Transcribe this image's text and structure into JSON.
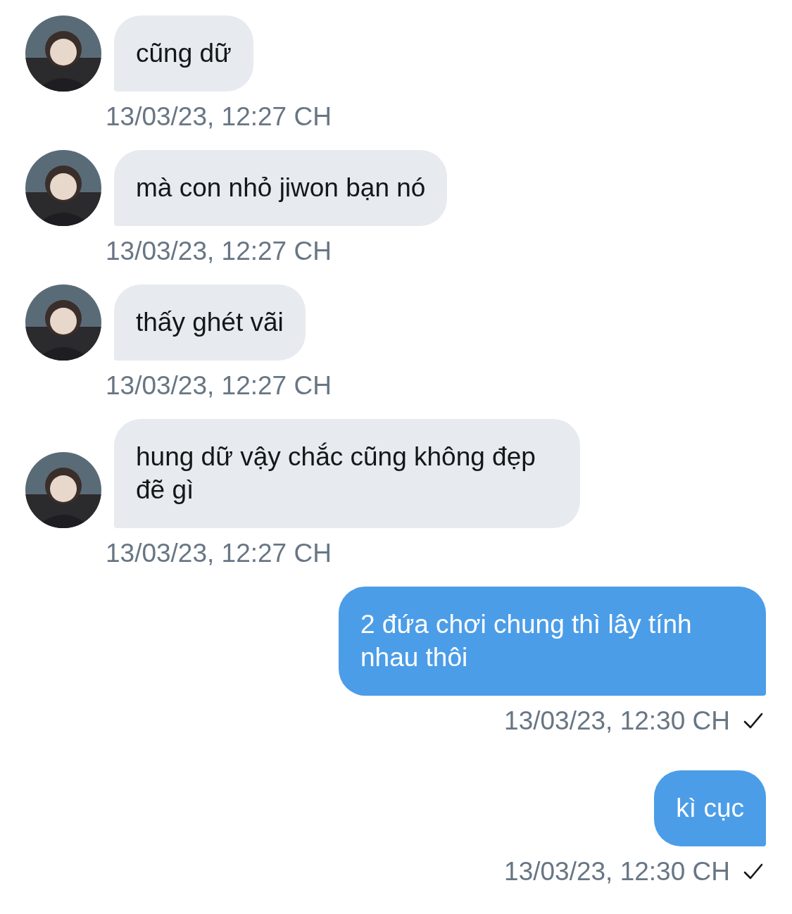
{
  "messages": [
    {
      "kind": "incoming",
      "text": "cũng dữ",
      "time": "13/03/23, 12:27 CH"
    },
    {
      "kind": "incoming",
      "text": "mà con nhỏ jiwon bạn nó",
      "time": "13/03/23, 12:27 CH"
    },
    {
      "kind": "incoming",
      "text": "thấy ghét vãi",
      "time": "13/03/23, 12:27 CH"
    },
    {
      "kind": "incoming",
      "text": "hung dữ vậy chắc cũng không đẹp đẽ gì",
      "time": "13/03/23, 12:27 CH"
    },
    {
      "kind": "outgoing",
      "text": "2 đứa chơi chung thì lây tính nhau thôi",
      "time": "13/03/23, 12:30 CH",
      "sent": true
    },
    {
      "kind": "outgoing",
      "text": "kì cục",
      "time": "13/03/23, 12:30 CH",
      "sent": true
    }
  ]
}
